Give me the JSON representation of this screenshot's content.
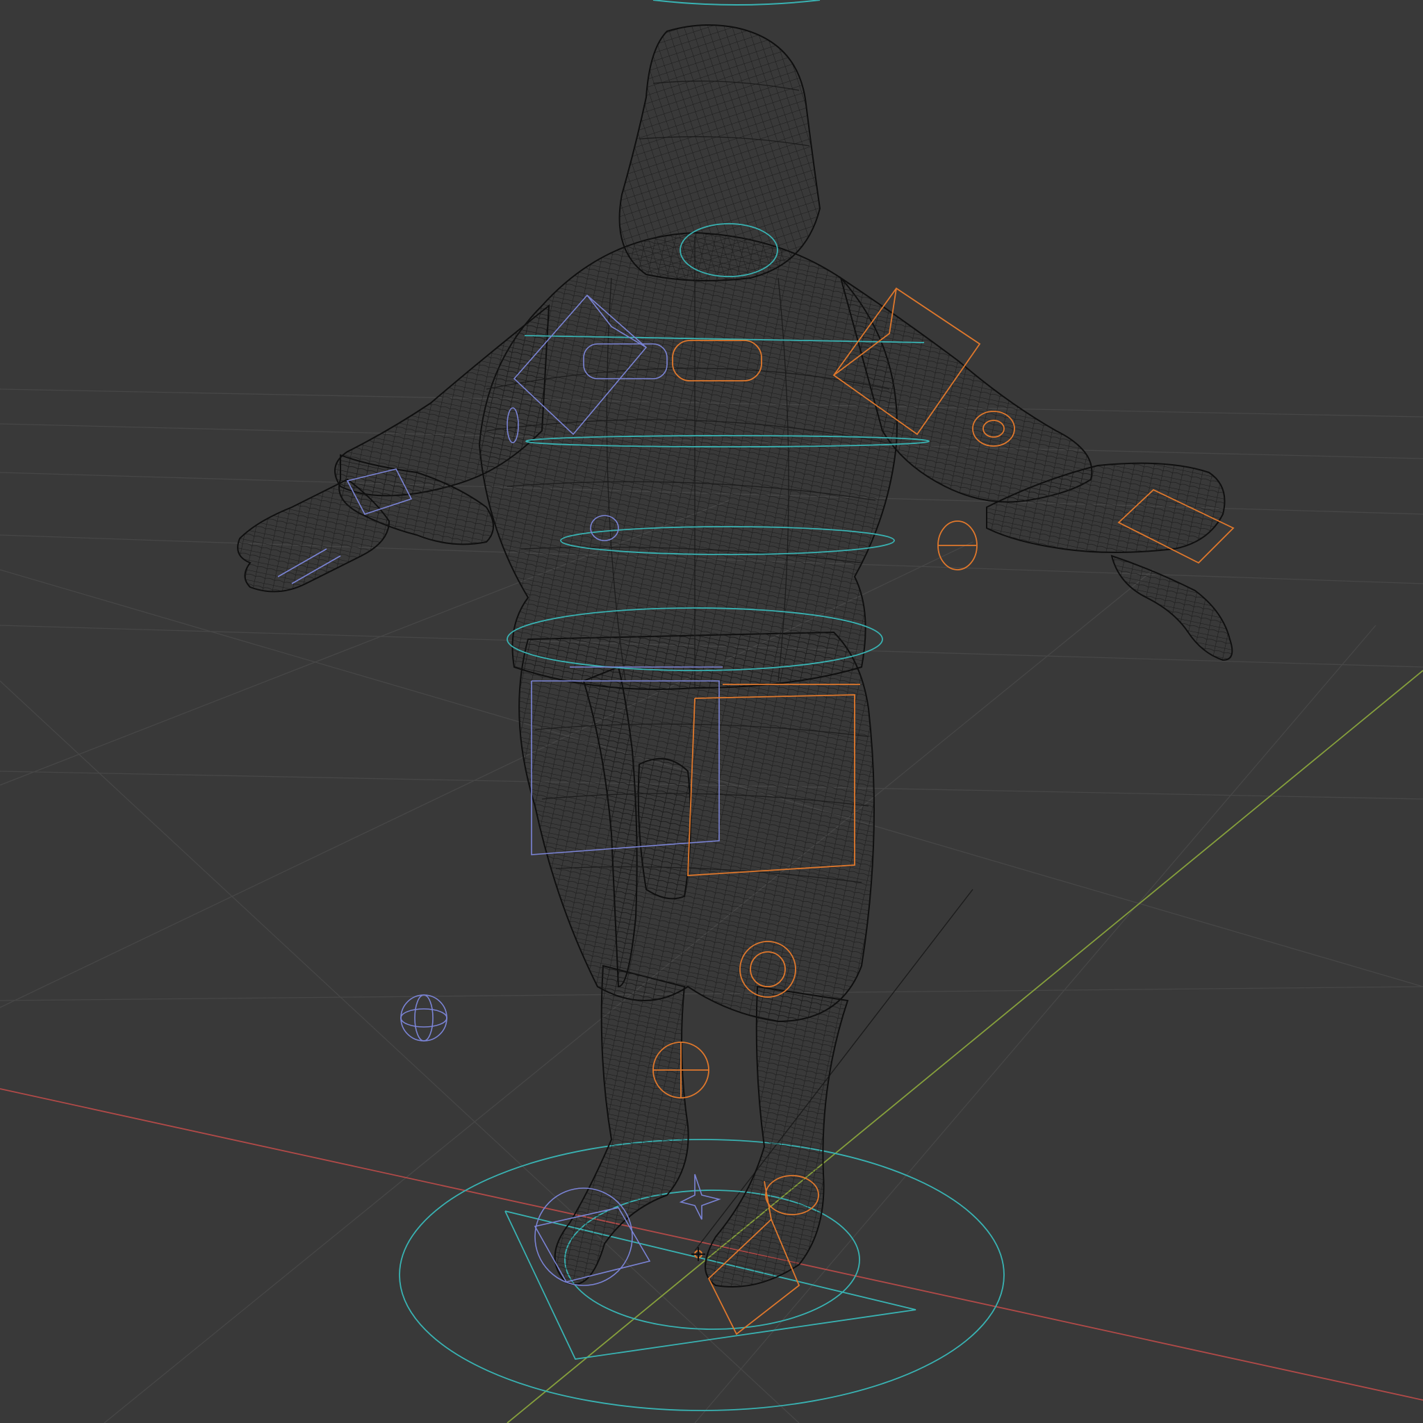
{
  "viewport": {
    "background": "#393939",
    "grid_color": "#4a4a4a",
    "x_axis_color": "#c0504d",
    "y_axis_color": "#8aa043",
    "mesh_color": "#111111",
    "cyan_control_color": "#39b3b3",
    "left_control_color": "#7b84d6",
    "right_control_color": "#e0782c",
    "center_marker_color": "#e0782c"
  },
  "objects": {
    "character_mesh": "wireframe-character",
    "rig": "armature-controls"
  }
}
